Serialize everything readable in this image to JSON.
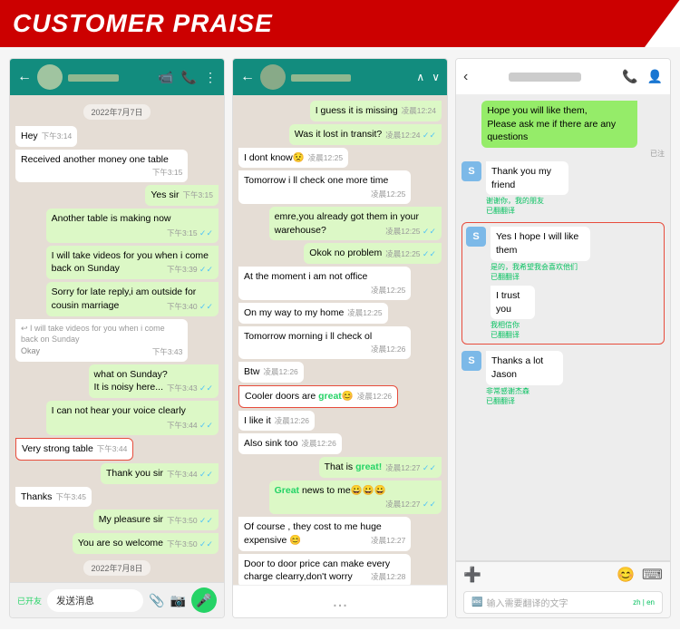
{
  "header": {
    "title": "CUSTOMER PRAISE"
  },
  "panel1": {
    "header": {
      "name": "Contact"
    },
    "messages": [
      {
        "id": "date1",
        "type": "date",
        "text": "2022年7月7日"
      },
      {
        "id": "m1",
        "type": "received",
        "text": "Hey",
        "time": "下午3:14"
      },
      {
        "id": "m2",
        "type": "received",
        "text": "Received another money one table",
        "time": "下午3:15"
      },
      {
        "id": "m3",
        "type": "sent",
        "text": "Yes sir",
        "time": "下午3:15"
      },
      {
        "id": "m4",
        "type": "sent",
        "text": "Another table is making now",
        "time": "下午3:15",
        "tick": true
      },
      {
        "id": "m5",
        "type": "sent",
        "text": "I will take videos for you when i come back on Sunday",
        "time": "下午3:39",
        "tick": true
      },
      {
        "id": "m6",
        "type": "sent",
        "text": "Sorry for late reply,i am outside for cousin marriage",
        "time": "下午3:40",
        "tick": true
      },
      {
        "id": "m7",
        "type": "received",
        "text": "I will take videos for you when i come back on Sunday",
        "time": ""
      },
      {
        "id": "m8",
        "type": "received",
        "text": "Okay",
        "time": "下午3:43"
      },
      {
        "id": "m9",
        "type": "sent",
        "text": "what on Sunday?\nIt is noisy here...",
        "time": "下午3:43",
        "tick": true
      },
      {
        "id": "m10",
        "type": "sent",
        "text": "I can not hear your voice clearly",
        "time": "下午3:44",
        "tick": true
      },
      {
        "id": "m11",
        "type": "received",
        "text": "Very strong table",
        "time": "下午3:44",
        "highlighted": true
      },
      {
        "id": "m12",
        "type": "sent",
        "text": "Thank you sir",
        "time": "下午3:44",
        "tick": true
      },
      {
        "id": "m13",
        "type": "received",
        "text": "Thanks",
        "time": "下午3:45"
      },
      {
        "id": "m14",
        "type": "sent",
        "text": "My pleasure sir",
        "time": "下午3:50",
        "tick": true
      },
      {
        "id": "m15",
        "type": "sent",
        "text": "You are so welcome",
        "time": "下午3:50",
        "tick": true
      },
      {
        "id": "date2",
        "type": "date",
        "text": "2022年7月8日"
      }
    ],
    "footer": {
      "placeholder": "发送消息",
      "friend_status": "已开友"
    }
  },
  "panel2": {
    "header": {
      "name": "Contact"
    },
    "messages": [
      {
        "id": "m1",
        "type": "sent",
        "text": "I guess it is missing",
        "time": "凌晨12:24"
      },
      {
        "id": "m2",
        "type": "sent",
        "text": "Was it lost in transit?",
        "time": "凌晨12:24",
        "tick": true
      },
      {
        "id": "m3",
        "type": "received",
        "text": "I dont know😟",
        "time": "凌晨12:25"
      },
      {
        "id": "m4",
        "type": "received",
        "text": "Tomorrow i ll check one more time",
        "time": "凌晨12:25"
      },
      {
        "id": "m5",
        "type": "sent",
        "text": "emre,you already got them in your warehouse?",
        "time": "凌晨12:25",
        "tick": true
      },
      {
        "id": "m6",
        "type": "sent",
        "text": "Okok no problem",
        "time": "凌晨12:25",
        "tick": true
      },
      {
        "id": "m7",
        "type": "received",
        "text": "At the moment i am not office",
        "time": "凌晨12:25"
      },
      {
        "id": "m8",
        "type": "received",
        "text": "On my way to my home",
        "time": "凌晨12:25"
      },
      {
        "id": "m9",
        "type": "received",
        "text": "Tomorrow morning i ll check ol",
        "time": "凌晨12:26"
      },
      {
        "id": "m10",
        "type": "received",
        "text": "Btw",
        "time": "凌晨12:26"
      },
      {
        "id": "m11",
        "type": "received",
        "text": "Cooler doors are great😊",
        "time": "凌晨12:26",
        "highlighted": true
      },
      {
        "id": "m12",
        "type": "received",
        "text": "I like it",
        "time": "凌晨12:26"
      },
      {
        "id": "m13",
        "type": "received",
        "text": "Also sink too",
        "time": "凌晨12:26"
      },
      {
        "id": "m14",
        "type": "sent",
        "text": "That is great!",
        "time": "凌晨12:27",
        "tick": true
      },
      {
        "id": "m15",
        "type": "sent",
        "text": "Great news to me😀😀😀",
        "time": "凌晨12:27",
        "tick": true
      },
      {
        "id": "m16",
        "type": "received",
        "text": "Of course , they cost to me huge expensive 😊",
        "time": "凌晨12:27"
      },
      {
        "id": "m17",
        "type": "received",
        "text": "Door to door price can make every charge clearry,don't worry",
        "time": "凌晨12:28"
      }
    ],
    "footer": {}
  },
  "panel3": {
    "header": {
      "name": "Contact"
    },
    "messages": [
      {
        "id": "m1",
        "type": "sent",
        "text": "Hope you will like them,\nPlease ask me if there are any questions",
        "translate": "已注"
      },
      {
        "id": "m2",
        "type": "received",
        "avatar": "S",
        "text": "Thank you my friend",
        "translate": "谢谢你，我的朋友",
        "translate_label": "已翻翻译"
      },
      {
        "id": "m3",
        "type": "received-highlighted",
        "avatar": "S",
        "text": "Yes I hope I will like them",
        "translate": "是的，我希望我会喜欢他们",
        "translate_label": "已翻翻译"
      },
      {
        "id": "m4",
        "type": "received-highlighted",
        "avatar": "",
        "text": "I trust you",
        "translate": "我相信你",
        "translate_label": "已翻翻译"
      },
      {
        "id": "m5",
        "type": "received",
        "avatar": "S",
        "text": "Thanks a lot Jason",
        "translate": "非常感谢杰森",
        "translate_label": "已翻翻译"
      }
    ],
    "footer": {
      "placeholder": "输入需要翻译的文字",
      "lang": "zh | en"
    }
  },
  "icons": {
    "back": "←",
    "video": "📹",
    "phone": "📞",
    "more": "⋮",
    "search": "🔍",
    "chevron_up": "∧",
    "chevron_down": "∨",
    "attach": "📎",
    "camera": "📷",
    "mic": "🎤",
    "emoji": "😊",
    "plus": "+",
    "keyboard": "⌨",
    "call": "📞",
    "contacts": "👤",
    "translate": "🔤"
  }
}
